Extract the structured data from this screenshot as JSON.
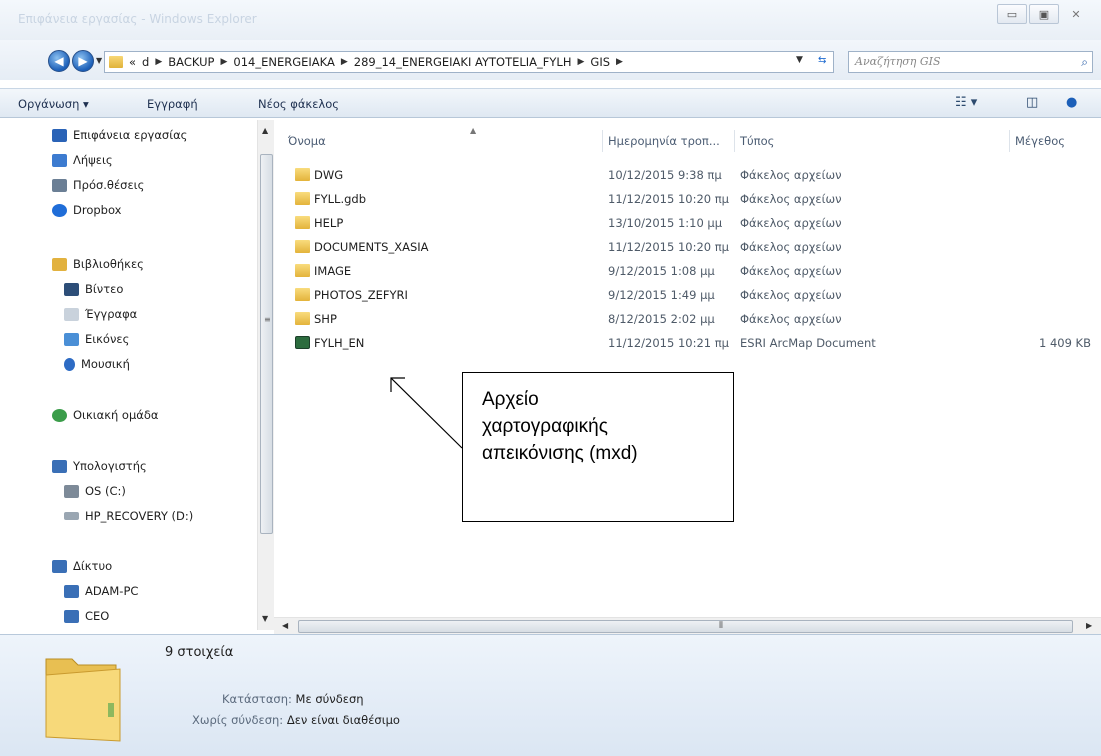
{
  "window": {
    "title": "Επιφάνεια εργασίας - Windows Explorer",
    "controls": {
      "minimize": "▭",
      "maximize": "▣",
      "close": "✕"
    }
  },
  "address": {
    "path": [
      "«",
      "d",
      "BACKUP",
      "014_ENERGEIAKA",
      "289_14_ENERGEIAKI AYTOTELIA_FYLH",
      "GIS"
    ],
    "search_placeholder": "Αναζήτηση GIS"
  },
  "toolbar": {
    "organize": "Οργάνωση ▾",
    "burn": "Εγγραφή",
    "new_folder": "Νέος φάκελος"
  },
  "sidebar": {
    "items": [
      {
        "label": "Επιφάνεια εργασίας",
        "icon": "desktop-icon",
        "color": "#2a63b7"
      },
      {
        "label": "Λήψεις",
        "icon": "downloads-icon",
        "color": "#3c7bd0"
      },
      {
        "label": "Πρόσ.θέσεις",
        "icon": "recent-places-icon",
        "color": "#6b7f95"
      },
      {
        "label": "Dropbox",
        "icon": "dropbox-icon",
        "color": "#1f6dd8"
      },
      {
        "label": "Βιβλιοθήκες",
        "icon": "libraries-icon",
        "color": "#e2b23f"
      },
      {
        "label": "Βίντεο",
        "icon": "video-icon",
        "color": "#2d4e78"
      },
      {
        "label": "Έγγραφα",
        "icon": "documents-icon",
        "color": "#c9d2dc"
      },
      {
        "label": "Εικόνες",
        "icon": "pictures-icon",
        "color": "#4a8fd6"
      },
      {
        "label": "Μουσική",
        "icon": "music-icon",
        "color": "#2d6bc4"
      },
      {
        "label": "Οικιακή ομάδα",
        "icon": "homegroup-icon",
        "color": "#3b9d4a"
      },
      {
        "label": "Υπολογιστής",
        "icon": "computer-icon",
        "color": "#3a6fb6"
      },
      {
        "label": "OS (C:)",
        "icon": "drive-c-icon",
        "color": "#7d8a98"
      },
      {
        "label": "HP_RECOVERY (D:)",
        "icon": "drive-d-icon",
        "color": "#9aa6b2"
      },
      {
        "label": "Δίκτυο",
        "icon": "network-icon",
        "color": "#3a6fb6"
      },
      {
        "label": "ADAM-PC",
        "icon": "pc-icon",
        "color": "#3a6fb6"
      },
      {
        "label": "CEO",
        "icon": "pc-icon",
        "color": "#3a6fb6"
      }
    ]
  },
  "filelist": {
    "headers": {
      "name": "Όνομα",
      "date": "Ημερομηνία τροπ...",
      "type": "Τύπος",
      "size": "Μέγεθος"
    },
    "rows": [
      {
        "name": "DWG",
        "date": "10/12/2015 9:38 πμ",
        "type": "Φάκελος αρχείων",
        "size": "",
        "kind": "folder"
      },
      {
        "name": "FYLL.gdb",
        "date": "11/12/2015 10:20 πμ",
        "type": "Φάκελος αρχείων",
        "size": "",
        "kind": "folder"
      },
      {
        "name": "HELP",
        "date": "13/10/2015 1:10 μμ",
        "type": "Φάκελος αρχείων",
        "size": "",
        "kind": "folder"
      },
      {
        "name": "DOCUMENTS_XASIA",
        "date": "11/12/2015 10:20 πμ",
        "type": "Φάκελος αρχείων",
        "size": "",
        "kind": "folder"
      },
      {
        "name": "IMAGE",
        "date": "9/12/2015 1:08 μμ",
        "type": "Φάκελος αρχείων",
        "size": "",
        "kind": "folder"
      },
      {
        "name": "PHOTOS_ZEFYRI",
        "date": "9/12/2015 1:49 μμ",
        "type": "Φάκελος αρχείων",
        "size": "",
        "kind": "folder"
      },
      {
        "name": "SHP",
        "date": "8/12/2015 2:02 μμ",
        "type": "Φάκελος αρχείων",
        "size": "",
        "kind": "folder"
      },
      {
        "name": "FYLH_EN",
        "date": "11/12/2015 10:21 πμ",
        "type": "ESRI ArcMap Document",
        "size": "1 409 KB",
        "kind": "mxd"
      }
    ]
  },
  "details": {
    "count": "9 στοιχεία",
    "status_key": "Κατάσταση:",
    "status_val": "Με σύνδεση",
    "offline_key": "Χωρίς σύνδεση:",
    "offline_val": "Δεν είναι διαθέσιμο"
  },
  "callout": {
    "lines": [
      "Αρχείο",
      "χαρτογραφικής",
      "απεικόνισης (mxd)"
    ]
  }
}
